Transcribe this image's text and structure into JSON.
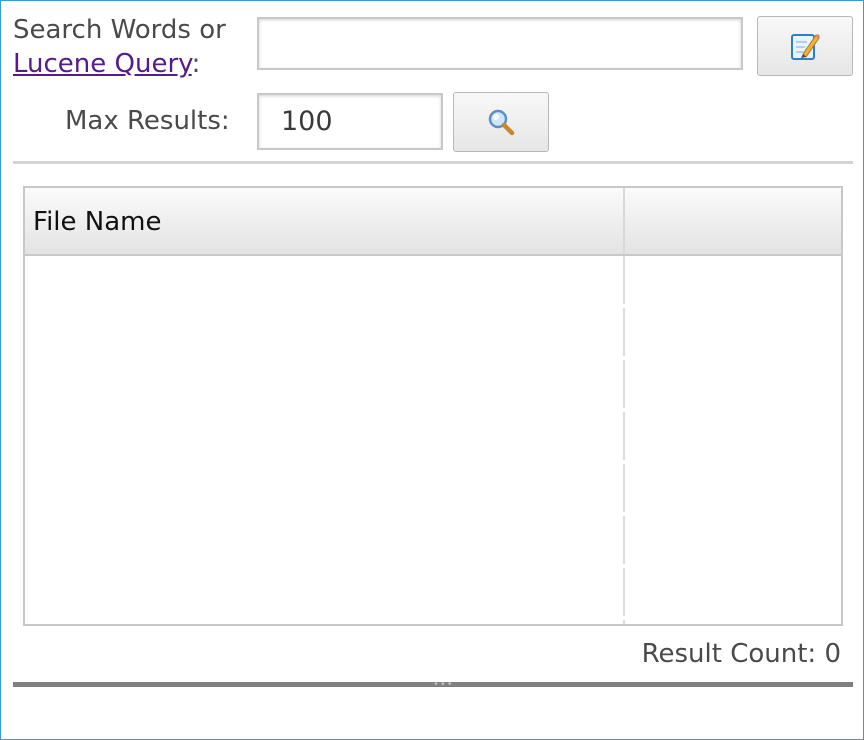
{
  "search": {
    "label_prefix": "Search Words or",
    "link_text": "Lucene Query",
    "label_suffix": ":",
    "query_value": ""
  },
  "max_results": {
    "label": "Max Results:",
    "value": "100"
  },
  "buttons": {
    "edit_icon": "edit-pencil-icon",
    "search_icon": "magnifier-icon"
  },
  "table": {
    "columns": [
      "File Name",
      ""
    ],
    "rows": []
  },
  "result_count": {
    "label": "Result Count: 0"
  },
  "colors": {
    "frame_border": "#3a9ad9",
    "link": "#551a8b",
    "splitter": "#808080"
  }
}
